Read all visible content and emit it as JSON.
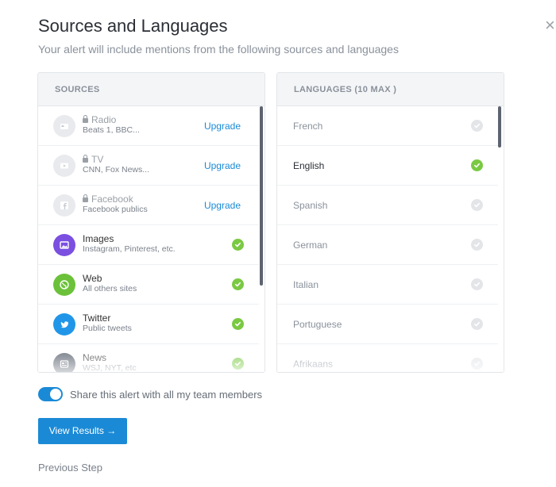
{
  "header": {
    "title": "Sources and Languages",
    "subtitle": "Your alert will include mentions from the following sources and languages",
    "close_glyph": "×"
  },
  "sources": {
    "heading": "SOURCES",
    "items": [
      {
        "name": "Radio",
        "sub": "Beats 1, BBC...",
        "locked": true,
        "action": "Upgrade",
        "icon": "radio-icon",
        "color": "#e8eaed"
      },
      {
        "name": "TV",
        "sub": "CNN, Fox News...",
        "locked": true,
        "action": "Upgrade",
        "icon": "tv-icon",
        "color": "#e8eaed"
      },
      {
        "name": "Facebook",
        "sub": "Facebook publics",
        "locked": true,
        "action": "Upgrade",
        "icon": "facebook-icon",
        "color": "#e8eaed"
      },
      {
        "name": "Images",
        "sub": "Instagram, Pinterest, etc.",
        "locked": false,
        "selected": true,
        "icon": "image-icon",
        "color": "#7b4fe0"
      },
      {
        "name": "Web",
        "sub": "All others sites",
        "locked": false,
        "selected": true,
        "icon": "globe-icon",
        "color": "#6cc13a"
      },
      {
        "name": "Twitter",
        "sub": "Public tweets",
        "locked": false,
        "selected": true,
        "icon": "twitter-icon",
        "color": "#2196e8"
      },
      {
        "name": "News",
        "sub": "WSJ, NYT, etc",
        "locked": false,
        "selected": true,
        "icon": "news-icon",
        "color": "#505866"
      }
    ]
  },
  "languages": {
    "heading": "LANGUAGES (10 MAX )",
    "items": [
      {
        "name": "French",
        "selected": false
      },
      {
        "name": "English",
        "selected": true
      },
      {
        "name": "Spanish",
        "selected": false
      },
      {
        "name": "German",
        "selected": false
      },
      {
        "name": "Italian",
        "selected": false
      },
      {
        "name": "Portuguese",
        "selected": false
      },
      {
        "name": "Afrikaans",
        "selected": false
      }
    ]
  },
  "share": {
    "label": "Share this alert with all my team members",
    "enabled": true
  },
  "actions": {
    "view_results": "View Results →",
    "previous_step": "Previous Step"
  },
  "colors": {
    "accent": "#1b8ad6",
    "check_on": "#7ac943",
    "check_off": "#e3e5e8"
  }
}
